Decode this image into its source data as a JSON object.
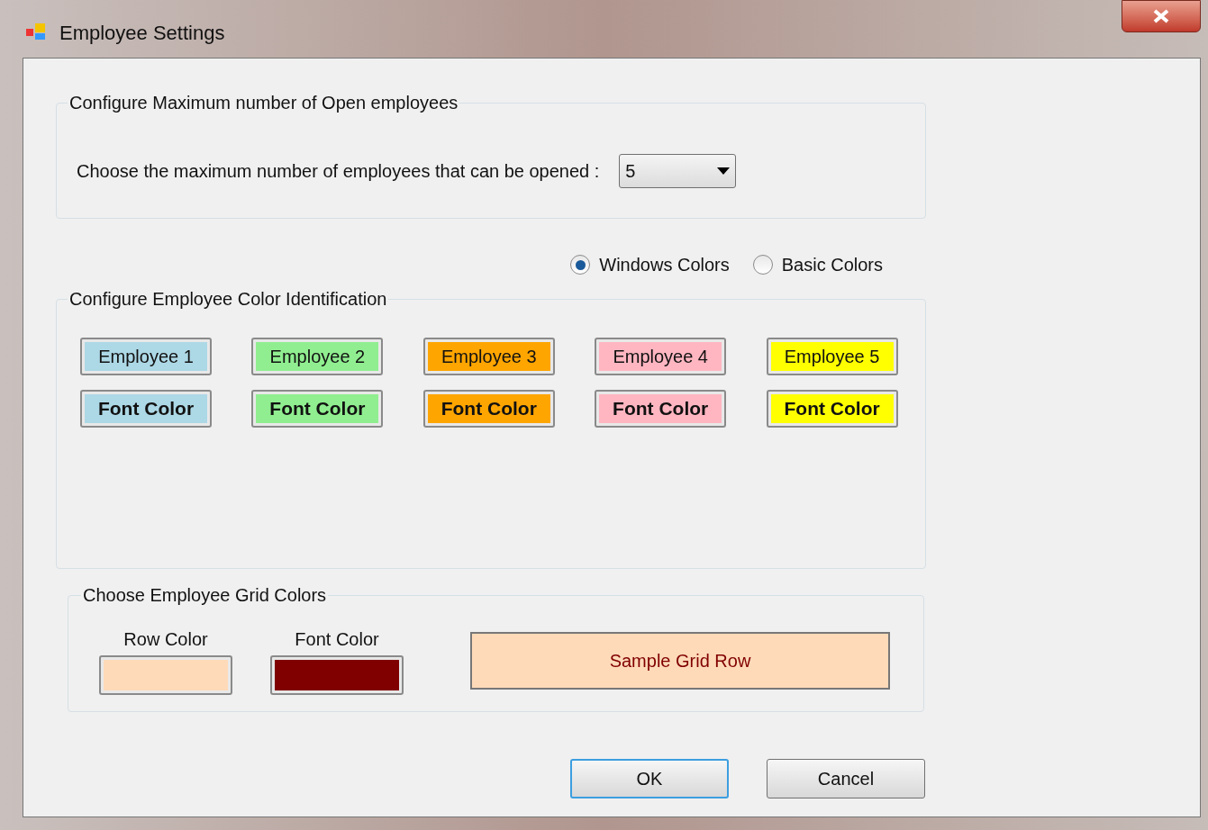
{
  "window": {
    "title": "Employee Settings"
  },
  "max_group": {
    "title": "Configure Maximum number of Open employees",
    "label": "Choose the maximum number of employees that can be opened :",
    "dropdown": {
      "value": "5"
    }
  },
  "color_schemes": [
    {
      "label": "Windows Colors",
      "selected": true
    },
    {
      "label": "Basic Colors",
      "selected": false
    }
  ],
  "color_group": {
    "title": "Configure Employee Color Identification",
    "employees": [
      {
        "label": "Employee 1",
        "font_label": "Font Color",
        "color": "#add8e6"
      },
      {
        "label": "Employee 2",
        "font_label": "Font Color",
        "color": "#90ee90"
      },
      {
        "label": "Employee 3",
        "font_label": "Font Color",
        "color": "#ffa500"
      },
      {
        "label": "Employee 4",
        "font_label": "Font Color",
        "color": "#ffb6c1"
      },
      {
        "label": "Employee 5",
        "font_label": "Font Color",
        "color": "#ffff00"
      }
    ]
  },
  "grid_group": {
    "title": "Choose Employee Grid Colors",
    "row_color": {
      "label": "Row Color",
      "color": "#ffdab9"
    },
    "font_color": {
      "label": "Font Color",
      "color": "#800000"
    },
    "sample": "Sample Grid Row"
  },
  "buttons": [
    {
      "label": "OK",
      "focused": true
    },
    {
      "label": "Cancel",
      "focused": false
    }
  ]
}
